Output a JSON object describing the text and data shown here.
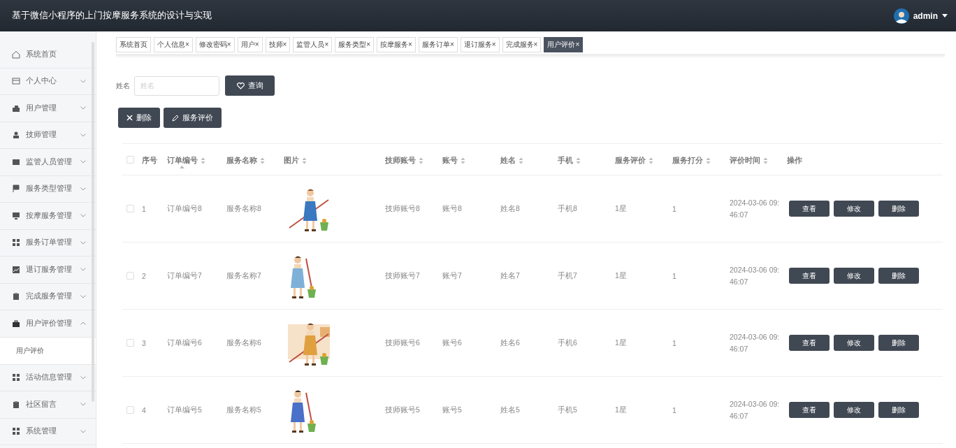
{
  "header": {
    "title": "基于微信小程序的上门按摩服务系统的设计与实现",
    "user": "admin"
  },
  "sidebar": {
    "items": [
      {
        "label": "系统首页",
        "kind": "link"
      },
      {
        "label": "个人中心",
        "kind": "menu",
        "expanded": false
      },
      {
        "label": "用户管理",
        "kind": "menu",
        "expanded": false
      },
      {
        "label": "技师管理",
        "kind": "menu",
        "expanded": false
      },
      {
        "label": "监管人员管理",
        "kind": "menu",
        "expanded": false
      },
      {
        "label": "服务类型管理",
        "kind": "menu",
        "expanded": false
      },
      {
        "label": "按摩服务管理",
        "kind": "menu",
        "expanded": false
      },
      {
        "label": "服务订单管理",
        "kind": "menu",
        "expanded": false
      },
      {
        "label": "退订服务管理",
        "kind": "menu",
        "expanded": false
      },
      {
        "label": "完成服务管理",
        "kind": "menu",
        "expanded": false
      },
      {
        "label": "用户评价管理",
        "kind": "menu",
        "expanded": true,
        "children": [
          {
            "label": "用户评价",
            "selected": true
          }
        ]
      },
      {
        "label": "活动信息管理",
        "kind": "menu",
        "expanded": false
      },
      {
        "label": "社区留言",
        "kind": "menu",
        "expanded": false
      },
      {
        "label": "系统管理",
        "kind": "menu",
        "expanded": false
      }
    ]
  },
  "tabs": [
    {
      "label": "系统首页",
      "selected": false
    },
    {
      "label": "个人信息",
      "close": "×",
      "selected": false
    },
    {
      "label": "修改密码",
      "close": "×",
      "selected": false
    },
    {
      "label": "用户",
      "close": "×",
      "selected": false
    },
    {
      "label": "技师",
      "close": "×",
      "selected": false
    },
    {
      "label": "监管人员",
      "close": "×",
      "selected": false
    },
    {
      "label": "服务类型",
      "close": "×",
      "selected": false
    },
    {
      "label": "按摩服务",
      "close": "×",
      "selected": false
    },
    {
      "label": "服务订单",
      "close": "×",
      "selected": false
    },
    {
      "label": "退订服务",
      "close": "×",
      "selected": false
    },
    {
      "label": "完成服务",
      "close": "×",
      "selected": false
    },
    {
      "label": "用户评价",
      "close": "×",
      "selected": true
    }
  ],
  "search": {
    "label": "姓名",
    "placeholder": "姓名",
    "button": "查询"
  },
  "actions": [
    "删除",
    "服务评价"
  ],
  "table": {
    "select_all_checked": false,
    "columns": [
      {
        "label": "序号",
        "sortable": false,
        "sort_hint": false
      },
      {
        "label": "订单编号",
        "sortable": true,
        "sort_hint": true
      },
      {
        "label": "服务名称",
        "sortable": true,
        "sort_hint": false
      },
      {
        "label": "图片",
        "sortable": true,
        "sort_hint": false
      },
      {
        "label": "技师账号",
        "sortable": true,
        "sort_hint": false
      },
      {
        "label": "账号",
        "sortable": true,
        "sort_hint": false
      },
      {
        "label": "姓名",
        "sortable": true,
        "sort_hint": false
      },
      {
        "label": "手机",
        "sortable": true,
        "sort_hint": false
      },
      {
        "label": "服务评价",
        "sortable": true,
        "sort_hint": false
      },
      {
        "label": "服务打分",
        "sortable": true,
        "sort_hint": false
      },
      {
        "label": "评价时间",
        "sortable": true,
        "sort_hint": false
      },
      {
        "label": "操作",
        "sortable": false,
        "sort_hint": false
      }
    ],
    "rows": [
      {
        "checked": false,
        "cells": [
          "1",
          "订单编号8",
          "服务名称8",
          {
            "kind": "picture"
          },
          "技师账号8",
          "账号8",
          "姓名8",
          "手机8",
          "1星",
          "1",
          "2024-03-06 09:46:07"
        ],
        "actions": [
          "查看",
          "修改",
          "删除"
        ]
      },
      {
        "checked": false,
        "cells": [
          "2",
          "订单编号7",
          "服务名称7",
          {
            "kind": "picture"
          },
          "技师账号7",
          "账号7",
          "姓名7",
          "手机7",
          "1星",
          "1",
          "2024-03-06 09:46:07"
        ],
        "actions": [
          "查看",
          "修改",
          "删除"
        ]
      },
      {
        "checked": false,
        "cells": [
          "3",
          "订单编号6",
          "服务名称6",
          {
            "kind": "picture"
          },
          "技师账号6",
          "账号6",
          "姓名6",
          "手机6",
          "1星",
          "1",
          "2024-03-06 09:46:07"
        ],
        "actions": [
          "查看",
          "修改",
          "删除"
        ]
      },
      {
        "checked": false,
        "cells": [
          "4",
          "订单编号5",
          "服务名称5",
          {
            "kind": "picture"
          },
          "技师账号5",
          "账号5",
          "姓名5",
          "手机5",
          "1星",
          "1",
          "2024-03-06 09:46:07"
        ],
        "actions": [
          "查看",
          "修改",
          "删除"
        ]
      }
    ]
  }
}
